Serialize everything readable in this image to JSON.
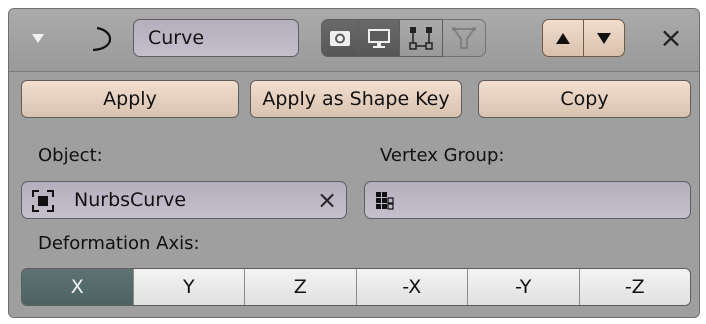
{
  "header": {
    "name": "Curve",
    "close_symbol": "×"
  },
  "actions": {
    "apply": "Apply",
    "apply_shape_key": "Apply as Shape Key",
    "copy": "Copy"
  },
  "object": {
    "label": "Object:",
    "value": "NurbsCurve",
    "clear_symbol": "×"
  },
  "vertex_group": {
    "label": "Vertex Group:",
    "value": ""
  },
  "deformation_axis": {
    "label": "Deformation Axis:",
    "options": [
      "X",
      "Y",
      "Z",
      "-X",
      "-Y",
      "-Z"
    ],
    "selected": "X"
  },
  "icons": {
    "collapse": "triangle-down-icon",
    "modifier": "curve-modifier-icon",
    "render": "camera-icon",
    "viewport": "monitor-icon",
    "editmode": "edit-mode-icon",
    "cage": "cage-icon",
    "move_up": "arrow-up-icon",
    "move_down": "arrow-down-icon",
    "object": "object-icon",
    "vertex_group": "vertex-group-icon"
  },
  "colors": {
    "panel_bg": "#9f9f9f",
    "button_bg": "#e6cfbe",
    "field_bg": "#bcb6c4",
    "selected_axis": "#556b69"
  }
}
